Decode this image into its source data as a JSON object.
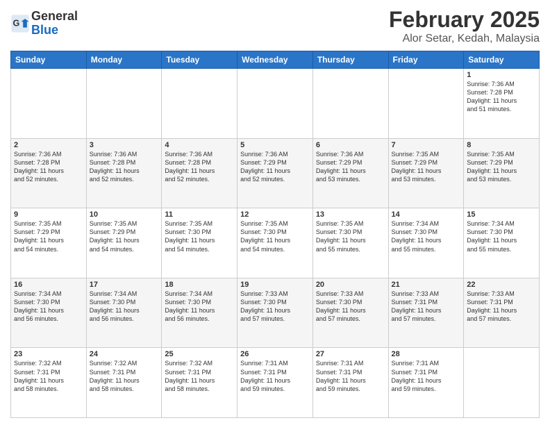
{
  "header": {
    "logo": {
      "general": "General",
      "blue": "Blue"
    },
    "title": "February 2025",
    "subtitle": "Alor Setar, Kedah, Malaysia"
  },
  "weekdays": [
    "Sunday",
    "Monday",
    "Tuesday",
    "Wednesday",
    "Thursday",
    "Friday",
    "Saturday"
  ],
  "weeks": [
    [
      {
        "day": "",
        "info": ""
      },
      {
        "day": "",
        "info": ""
      },
      {
        "day": "",
        "info": ""
      },
      {
        "day": "",
        "info": ""
      },
      {
        "day": "",
        "info": ""
      },
      {
        "day": "",
        "info": ""
      },
      {
        "day": "1",
        "info": "Sunrise: 7:36 AM\nSunset: 7:28 PM\nDaylight: 11 hours\nand 51 minutes."
      }
    ],
    [
      {
        "day": "2",
        "info": "Sunrise: 7:36 AM\nSunset: 7:28 PM\nDaylight: 11 hours\nand 52 minutes."
      },
      {
        "day": "3",
        "info": "Sunrise: 7:36 AM\nSunset: 7:28 PM\nDaylight: 11 hours\nand 52 minutes."
      },
      {
        "day": "4",
        "info": "Sunrise: 7:36 AM\nSunset: 7:28 PM\nDaylight: 11 hours\nand 52 minutes."
      },
      {
        "day": "5",
        "info": "Sunrise: 7:36 AM\nSunset: 7:29 PM\nDaylight: 11 hours\nand 52 minutes."
      },
      {
        "day": "6",
        "info": "Sunrise: 7:36 AM\nSunset: 7:29 PM\nDaylight: 11 hours\nand 53 minutes."
      },
      {
        "day": "7",
        "info": "Sunrise: 7:35 AM\nSunset: 7:29 PM\nDaylight: 11 hours\nand 53 minutes."
      },
      {
        "day": "8",
        "info": "Sunrise: 7:35 AM\nSunset: 7:29 PM\nDaylight: 11 hours\nand 53 minutes."
      }
    ],
    [
      {
        "day": "9",
        "info": "Sunrise: 7:35 AM\nSunset: 7:29 PM\nDaylight: 11 hours\nand 54 minutes."
      },
      {
        "day": "10",
        "info": "Sunrise: 7:35 AM\nSunset: 7:29 PM\nDaylight: 11 hours\nand 54 minutes."
      },
      {
        "day": "11",
        "info": "Sunrise: 7:35 AM\nSunset: 7:30 PM\nDaylight: 11 hours\nand 54 minutes."
      },
      {
        "day": "12",
        "info": "Sunrise: 7:35 AM\nSunset: 7:30 PM\nDaylight: 11 hours\nand 54 minutes."
      },
      {
        "day": "13",
        "info": "Sunrise: 7:35 AM\nSunset: 7:30 PM\nDaylight: 11 hours\nand 55 minutes."
      },
      {
        "day": "14",
        "info": "Sunrise: 7:34 AM\nSunset: 7:30 PM\nDaylight: 11 hours\nand 55 minutes."
      },
      {
        "day": "15",
        "info": "Sunrise: 7:34 AM\nSunset: 7:30 PM\nDaylight: 11 hours\nand 55 minutes."
      }
    ],
    [
      {
        "day": "16",
        "info": "Sunrise: 7:34 AM\nSunset: 7:30 PM\nDaylight: 11 hours\nand 56 minutes."
      },
      {
        "day": "17",
        "info": "Sunrise: 7:34 AM\nSunset: 7:30 PM\nDaylight: 11 hours\nand 56 minutes."
      },
      {
        "day": "18",
        "info": "Sunrise: 7:34 AM\nSunset: 7:30 PM\nDaylight: 11 hours\nand 56 minutes."
      },
      {
        "day": "19",
        "info": "Sunrise: 7:33 AM\nSunset: 7:30 PM\nDaylight: 11 hours\nand 57 minutes."
      },
      {
        "day": "20",
        "info": "Sunrise: 7:33 AM\nSunset: 7:30 PM\nDaylight: 11 hours\nand 57 minutes."
      },
      {
        "day": "21",
        "info": "Sunrise: 7:33 AM\nSunset: 7:31 PM\nDaylight: 11 hours\nand 57 minutes."
      },
      {
        "day": "22",
        "info": "Sunrise: 7:33 AM\nSunset: 7:31 PM\nDaylight: 11 hours\nand 57 minutes."
      }
    ],
    [
      {
        "day": "23",
        "info": "Sunrise: 7:32 AM\nSunset: 7:31 PM\nDaylight: 11 hours\nand 58 minutes."
      },
      {
        "day": "24",
        "info": "Sunrise: 7:32 AM\nSunset: 7:31 PM\nDaylight: 11 hours\nand 58 minutes."
      },
      {
        "day": "25",
        "info": "Sunrise: 7:32 AM\nSunset: 7:31 PM\nDaylight: 11 hours\nand 58 minutes."
      },
      {
        "day": "26",
        "info": "Sunrise: 7:31 AM\nSunset: 7:31 PM\nDaylight: 11 hours\nand 59 minutes."
      },
      {
        "day": "27",
        "info": "Sunrise: 7:31 AM\nSunset: 7:31 PM\nDaylight: 11 hours\nand 59 minutes."
      },
      {
        "day": "28",
        "info": "Sunrise: 7:31 AM\nSunset: 7:31 PM\nDaylight: 11 hours\nand 59 minutes."
      },
      {
        "day": "",
        "info": ""
      }
    ]
  ]
}
